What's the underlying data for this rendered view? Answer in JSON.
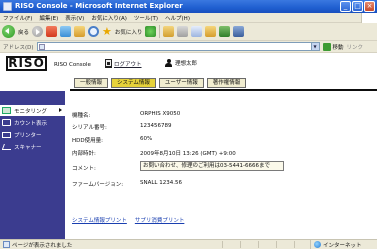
{
  "window": {
    "title": "RISO Console - Microsoft Internet Explorer",
    "buttons": [
      "_",
      "□",
      "×"
    ]
  },
  "menu": [
    "ファイル(F)",
    "編集(E)",
    "表示(V)",
    "お気に入り(A)",
    "ツール(T)",
    "ヘルプ(H)"
  ],
  "toolbar": {
    "back_label": "戻る",
    "favorites_label": "お気に入り"
  },
  "address": {
    "label": "アドレス(D)",
    "value": "",
    "go_label": "移動",
    "links_label": "リンク"
  },
  "header": {
    "logo": "RISO",
    "console_name": "RISO Console",
    "logout_label": "ログアウト",
    "user_name": "理想太郎"
  },
  "tabs": [
    {
      "label": "一般情報",
      "active": false
    },
    {
      "label": "システム情報",
      "active": true
    },
    {
      "label": "ユーザー情報",
      "active": false
    },
    {
      "label": "著作権情報",
      "active": false
    }
  ],
  "sidebar": {
    "items": [
      {
        "label": "モニタリング",
        "icon": "monitor-icon",
        "selected": true
      },
      {
        "label": "カウント表示",
        "icon": "count-icon",
        "selected": false
      },
      {
        "label": "プリンター",
        "icon": "printer-icon",
        "selected": false
      },
      {
        "label": "スキャナー",
        "icon": "scanner-icon",
        "selected": false
      }
    ]
  },
  "details": [
    {
      "label": "機種名:",
      "value": "ORPHIS X9050"
    },
    {
      "label": "シリアル番号:",
      "value": "123456789"
    },
    {
      "label": "HDD使用量:",
      "value": "60%"
    },
    {
      "label": "内部時計:",
      "value": "2009年8月10日 13:26 (GMT) +9:00"
    },
    {
      "label": "コメント:",
      "value": "お問い合わせ、修理のご利用は03-5441-6666まで"
    },
    {
      "label": "ファームバージョン:",
      "value": "SNALL 1234.56"
    }
  ],
  "links": [
    "システム情報プリント",
    "サプリ消費プリント"
  ],
  "status": {
    "text": "ページが表示されました",
    "zone": "インターネット"
  },
  "colors": {
    "sidebar": "#3b3c8f",
    "active_tab": "#e6d23a",
    "tab": "#f1edd0",
    "titlebar": "#1f5fd0"
  }
}
